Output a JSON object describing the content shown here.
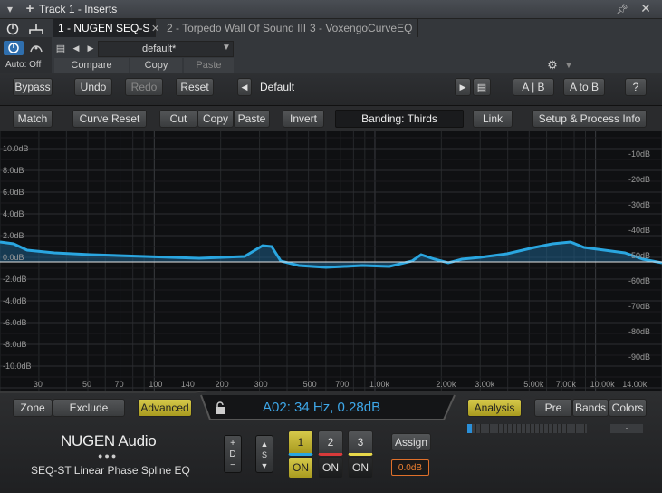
{
  "window": {
    "title": "Track 1 - Inserts"
  },
  "tabs": [
    {
      "label": "1 - NUGEN SEQ-S"
    },
    {
      "label": "2 - Torpedo Wall Of Sound III"
    },
    {
      "label": "3 - VoxengoCurveEQ"
    }
  ],
  "host": {
    "auto_label": "Auto: Off",
    "preset": "default*",
    "compare": "Compare",
    "copy": "Copy",
    "paste": "Paste"
  },
  "pluginbar": {
    "bypass": "Bypass",
    "undo": "Undo",
    "redo": "Redo",
    "reset": "Reset",
    "preset_name": "Default",
    "ab": "A | B",
    "atob": "A to B",
    "help": "?"
  },
  "toolbar": {
    "match": "Match",
    "curve_reset": "Curve Reset",
    "cut": "Cut",
    "copy": "Copy",
    "paste": "Paste",
    "invert": "Invert",
    "banding": "Banding: Thirds",
    "link": "Link",
    "setup": "Setup & Process Info"
  },
  "graph": {
    "left_db_labels": [
      "10.0dB",
      "8.0dB",
      "6.0dB",
      "4.0dB",
      "2.0dB",
      "0.0dB",
      "-2.0dB",
      "-4.0dB",
      "-6.0dB",
      "-8.0dB",
      "-10.0dB"
    ],
    "right_db_labels": [
      "-10dB",
      "-20dB",
      "-30dB",
      "-40dB",
      "-50dB",
      "-60dB",
      "-70dB",
      "-80dB",
      "-90dB"
    ],
    "freq_labels": [
      "30",
      "50",
      "70",
      "100",
      "140",
      "200",
      "300",
      "500",
      "700",
      "1.00k",
      "2.00k",
      "3.00k",
      "5.00k",
      "7.00k",
      "10.00k",
      "14.00k"
    ],
    "curve_color": "#2aa6e0"
  },
  "bottom": {
    "zone": "Zone",
    "exclude": "Exclude",
    "advanced": "Advanced",
    "readout": "A02: 34 Hz, 0.28dB",
    "analysis": "Analysis",
    "pre": "Pre",
    "bands": "Bands",
    "colors": "Colors",
    "brand": "NUGEN Audio",
    "product": "SEQ-ST Linear Phase Spline EQ",
    "d_label": "D",
    "s_label": "S",
    "slot1": "1",
    "slot2": "2",
    "slot3": "3",
    "on1": "ON",
    "on2": "ON",
    "on3": "ON",
    "assign": "Assign",
    "gain": "0.0dB"
  }
}
